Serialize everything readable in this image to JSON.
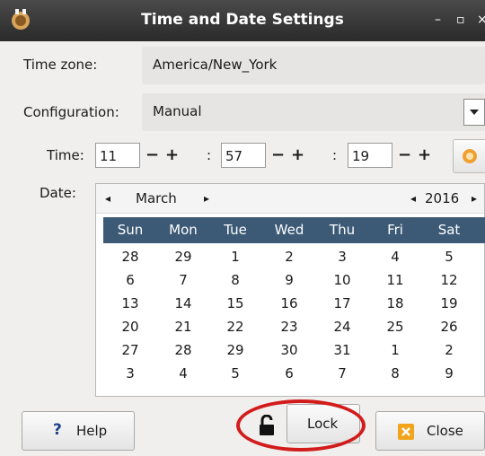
{
  "window": {
    "title": "Time and Date Settings",
    "minimize_glyph": "–",
    "maximize_glyph": "▫",
    "close_glyph": "×"
  },
  "timezone": {
    "label": "Time zone:",
    "value": "America/New_York"
  },
  "configuration": {
    "label": "Configuration:",
    "value": "Manual",
    "arrow": "▾"
  },
  "time": {
    "label": "Time:",
    "hours": "11",
    "minutes": "57",
    "seconds": "19",
    "separator": ":",
    "minus": "−",
    "plus": "+"
  },
  "date": {
    "label": "Date:",
    "month": "March",
    "year": "2016",
    "prev": "◂",
    "next": "▸",
    "weekdays": [
      "Sun",
      "Mon",
      "Tue",
      "Wed",
      "Thu",
      "Fri",
      "Sat"
    ],
    "weeks": [
      [
        "28",
        "29",
        "1",
        "2",
        "3",
        "4",
        "5"
      ],
      [
        "6",
        "7",
        "8",
        "9",
        "10",
        "11",
        "12"
      ],
      [
        "13",
        "14",
        "15",
        "16",
        "17",
        "18",
        "19"
      ],
      [
        "20",
        "21",
        "22",
        "23",
        "24",
        "25",
        "26"
      ],
      [
        "27",
        "28",
        "29",
        "30",
        "31",
        "1",
        "2"
      ],
      [
        "3",
        "4",
        "5",
        "6",
        "7",
        "8",
        "9"
      ]
    ]
  },
  "buttons": {
    "help": "Help",
    "help_glyph": "?",
    "lock": "Lock",
    "close": "Close"
  },
  "colors": {
    "title_bar": "#2f2f2f",
    "calendar_header": "#3c5a76",
    "highlight_ring": "#d21c1c",
    "sync_icon": "#f0a030"
  }
}
